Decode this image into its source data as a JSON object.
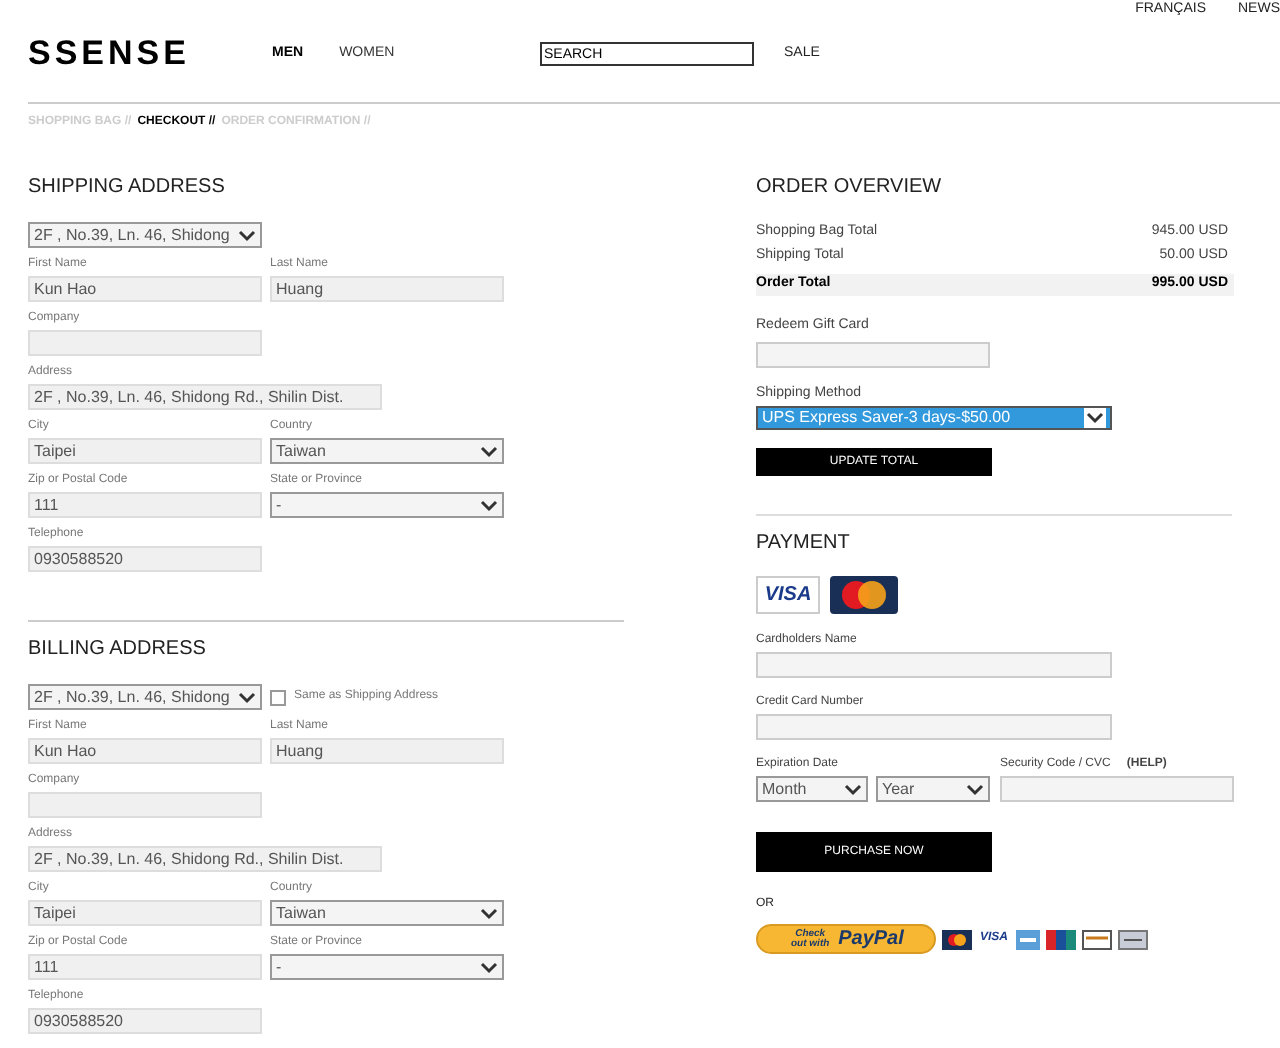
{
  "header": {
    "logo": "SSENSE",
    "nav": [
      {
        "label": "MEN",
        "selected": true
      },
      {
        "label": "WOMEN",
        "selected": false
      }
    ],
    "search": {
      "placeholder": "SEARCH"
    },
    "sale": "SALE",
    "top_links": [
      "FRANÇAIS",
      "NEWS"
    ]
  },
  "breadcrumb": [
    {
      "label": "SHOPPING BAG //",
      "selected": false
    },
    {
      "label": "CHECKOUT //",
      "selected": true
    },
    {
      "label": "ORDER CONFIRMATION //",
      "selected": false
    }
  ],
  "shipping_address": {
    "title": "SHIPPING ADDRESS",
    "address_select": "2F , No.39, Ln. 46, Shidong",
    "rows": [
      [
        {
          "label": "First Name",
          "value": "Kun Hao",
          "kind": "text"
        },
        {
          "label": "Last Name",
          "value": "Huang",
          "kind": "text"
        }
      ],
      [
        {
          "label": "Company",
          "kind": "text"
        }
      ],
      [
        {
          "label": "Address",
          "value": "2F , No.39, Ln. 46, Shidong Rd., Shilin Dist.",
          "kind": "wide"
        }
      ],
      [
        {
          "label": "City",
          "value": "Taipei",
          "kind": "text"
        },
        {
          "label": "Country",
          "value": "Taiwan",
          "kind": "select"
        }
      ],
      [
        {
          "label": "Zip or Postal Code",
          "value": "111",
          "kind": "text"
        },
        {
          "label": "State or Province",
          "value": "-",
          "kind": "select"
        }
      ],
      [
        {
          "label": "Telephone",
          "value": "0930588520",
          "kind": "text"
        }
      ]
    ]
  },
  "billing_address": {
    "title": "BILLING ADDRESS",
    "address_select": "2F , No.39, Ln. 46, Shidong",
    "same_as_shipping": {
      "label": "Same as Shipping Address",
      "checked": false
    },
    "rows": [
      [
        {
          "label": "First Name",
          "value": "Kun Hao",
          "kind": "text"
        },
        {
          "label": "Last Name",
          "value": "Huang",
          "kind": "text"
        }
      ],
      [
        {
          "label": "Company",
          "kind": "text"
        }
      ],
      [
        {
          "label": "Address",
          "value": "2F , No.39, Ln. 46, Shidong Rd., Shilin Dist.",
          "kind": "wide"
        }
      ],
      [
        {
          "label": "City",
          "value": "Taipei",
          "kind": "text"
        },
        {
          "label": "Country",
          "value": "Taiwan",
          "kind": "select"
        }
      ],
      [
        {
          "label": "Zip or Postal Code",
          "value": "111",
          "kind": "text"
        },
        {
          "label": "State or Province",
          "value": "-",
          "kind": "select"
        }
      ],
      [
        {
          "label": "Telephone",
          "value": "0930588520",
          "kind": "text"
        }
      ]
    ]
  },
  "order_overview": {
    "title": "ORDER OVERVIEW",
    "lines": [
      {
        "label": "Shopping Bag Total",
        "amount": "945.00 USD",
        "kind": "subtotal"
      },
      {
        "label": "Shipping Total",
        "amount": "50.00 USD",
        "kind": "subtotal"
      },
      {
        "label": "Order Total",
        "amount": "995.00 USD",
        "kind": "total"
      }
    ],
    "gift_card": {
      "label": "Redeem Gift Card"
    },
    "shipping_method": {
      "label": "Shipping Method",
      "value": "UPS Express Saver-3 days-$50.00"
    },
    "update_button": "UPDATE TOTAL"
  },
  "payment": {
    "title": "PAYMENT",
    "visa_card": "VISA",
    "cardholder": {
      "label": "Cardholders Name"
    },
    "card_number": {
      "label": "Credit Card Number"
    },
    "expiration": {
      "label": "Expiration Date",
      "month": "Month",
      "year": "Year"
    },
    "security": {
      "label": "Security Code / CVC",
      "help": "(HELP)"
    },
    "purchase_button": "PURCHASE NOW",
    "or": "OR",
    "paypal": {
      "prefix": "Check out with",
      "brand": "PayPal"
    },
    "small_visa": "VISA"
  }
}
